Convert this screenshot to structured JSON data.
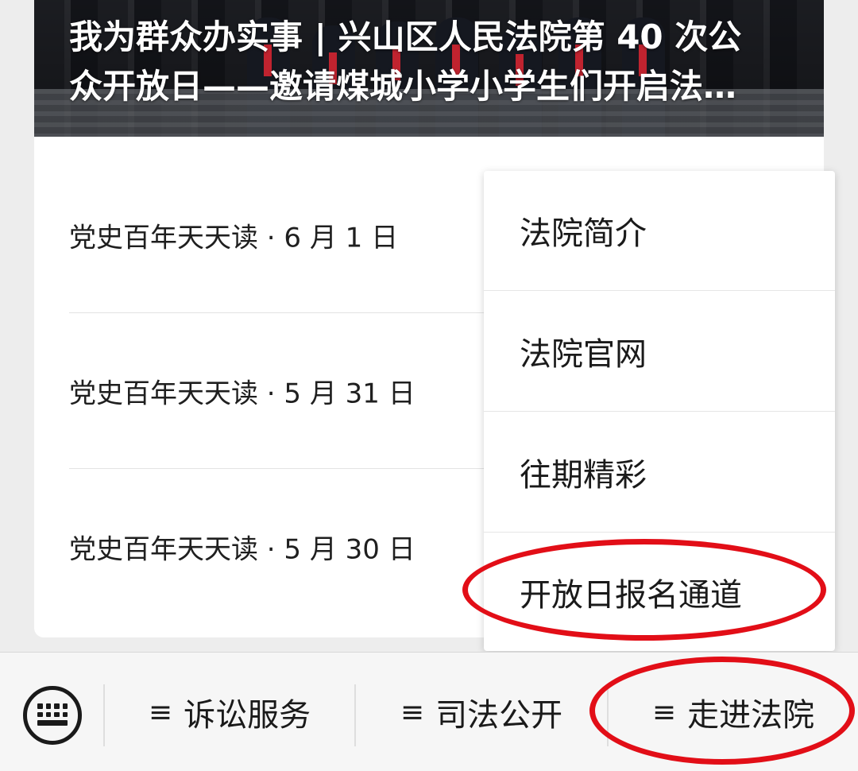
{
  "hero": {
    "title_line1": "我为群众办实事 | 兴山区人民法院第 40 次公",
    "title_line2": "众开放日——邀请煤城小学小学生们开启法…"
  },
  "list": {
    "items": [
      {
        "label": "党史百年天天读 · 6 月 1 日"
      },
      {
        "label": "党史百年天天读 · 5 月 31 日"
      },
      {
        "label": "党史百年天天读 · 5 月 30 日"
      }
    ]
  },
  "popup_menu": {
    "items": [
      {
        "label": "法院简介"
      },
      {
        "label": "法院官网"
      },
      {
        "label": "往期精彩"
      },
      {
        "label": "开放日报名通道"
      }
    ]
  },
  "bottom_bar": {
    "keyboard_icon": "keyboard-icon",
    "tabs": [
      {
        "icon": "≡",
        "label": "诉讼服务"
      },
      {
        "icon": "≡",
        "label": "司法公开"
      },
      {
        "icon": "≡",
        "label": "走进法院"
      }
    ]
  },
  "annotation_color": "#e20e17"
}
